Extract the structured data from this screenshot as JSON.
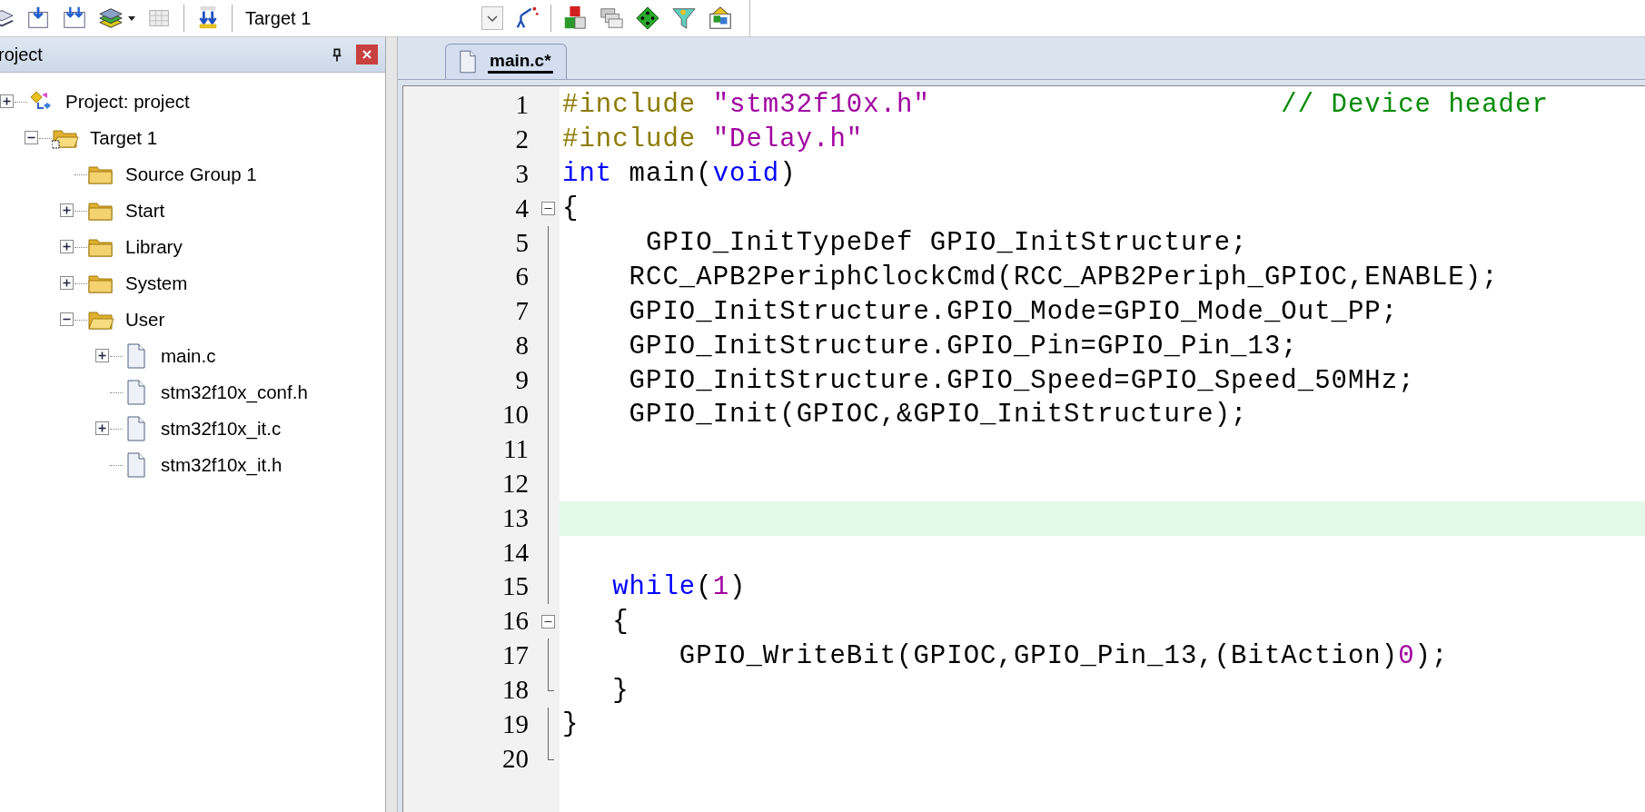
{
  "toolbar": {
    "target": "Target 1"
  },
  "project_panel": {
    "title": "roject",
    "tree": [
      {
        "label": "Project: project",
        "kind": "project",
        "expandable": true,
        "expanded": false,
        "children": [
          {
            "label": "Target 1",
            "kind": "target",
            "expandable": true,
            "expanded": true,
            "children": [
              {
                "label": "Source Group 1",
                "kind": "folder",
                "expandable": false
              },
              {
                "label": "Start",
                "kind": "folder",
                "expandable": true,
                "expanded": false
              },
              {
                "label": "Library",
                "kind": "folder",
                "expandable": true,
                "expanded": false
              },
              {
                "label": "System",
                "kind": "folder",
                "expandable": true,
                "expanded": false
              },
              {
                "label": "User",
                "kind": "folder",
                "expandable": true,
                "expanded": true,
                "children": [
                  {
                    "label": "main.c",
                    "kind": "file",
                    "expandable": true,
                    "expanded": false
                  },
                  {
                    "label": "stm32f10x_conf.h",
                    "kind": "file",
                    "expandable": false
                  },
                  {
                    "label": "stm32f10x_it.c",
                    "kind": "file",
                    "expandable": true,
                    "expanded": false
                  },
                  {
                    "label": "stm32f10x_it.h",
                    "kind": "file",
                    "expandable": false
                  }
                ]
              }
            ]
          }
        ]
      }
    ]
  },
  "editor": {
    "tabs": [
      {
        "label": "main.c*",
        "selected": true
      }
    ],
    "lines": [
      {
        "number": "1",
        "fold_marker": false,
        "fold_end": false,
        "in_fold": false,
        "current": false,
        "tokens": [
          {
            "kind": "preproc",
            "text": "#include "
          },
          {
            "kind": "string",
            "text": "\"stm32f10x.h\""
          },
          {
            "kind": "comment",
            "text": "                     // Device header"
          }
        ]
      },
      {
        "number": "2",
        "fold_marker": false,
        "fold_end": false,
        "in_fold": false,
        "current": false,
        "tokens": [
          {
            "kind": "preproc",
            "text": "#include "
          },
          {
            "kind": "string",
            "text": "\"Delay.h\""
          }
        ]
      },
      {
        "number": "3",
        "fold_marker": false,
        "fold_end": false,
        "in_fold": false,
        "current": false,
        "tokens": [
          {
            "kind": "keyword",
            "text": "int"
          },
          {
            "kind": "plain",
            "text": " main("
          },
          {
            "kind": "keyword",
            "text": "void"
          },
          {
            "kind": "plain",
            "text": ")"
          }
        ]
      },
      {
        "number": "4",
        "fold_marker": true,
        "fold_end": false,
        "in_fold": false,
        "current": false,
        "tokens": [
          {
            "kind": "plain",
            "text": "{"
          }
        ]
      },
      {
        "number": "5",
        "fold_marker": false,
        "fold_end": false,
        "in_fold": true,
        "current": false,
        "tokens": [
          {
            "kind": "plain",
            "text": "     GPIO_InitTypeDef GPIO_InitStructure;"
          }
        ]
      },
      {
        "number": "6",
        "fold_marker": false,
        "fold_end": false,
        "in_fold": true,
        "current": false,
        "tokens": [
          {
            "kind": "plain",
            "text": "    RCC_APB2PeriphClockCmd(RCC_APB2Periph_GPIOC,ENABLE);"
          }
        ]
      },
      {
        "number": "7",
        "fold_marker": false,
        "fold_end": false,
        "in_fold": true,
        "current": false,
        "tokens": [
          {
            "kind": "plain",
            "text": "    GPIO_InitStructure.GPIO_Mode=GPIO_Mode_Out_PP;"
          }
        ]
      },
      {
        "number": "8",
        "fold_marker": false,
        "fold_end": false,
        "in_fold": true,
        "current": false,
        "tokens": [
          {
            "kind": "plain",
            "text": "    GPIO_InitStructure.GPIO_Pin=GPIO_Pin_13;"
          }
        ]
      },
      {
        "number": "9",
        "fold_marker": false,
        "fold_end": false,
        "in_fold": true,
        "current": false,
        "tokens": [
          {
            "kind": "plain",
            "text": "    GPIO_InitStructure.GPIO_Speed=GPIO_Speed_50MHz;"
          }
        ]
      },
      {
        "number": "10",
        "fold_marker": false,
        "fold_end": false,
        "in_fold": true,
        "current": false,
        "tokens": [
          {
            "kind": "plain",
            "text": "    GPIO_Init(GPIOC,&GPIO_InitStructure);"
          }
        ]
      },
      {
        "number": "11",
        "fold_marker": false,
        "fold_end": false,
        "in_fold": true,
        "current": false
      },
      {
        "number": "12",
        "fold_marker": false,
        "fold_end": false,
        "in_fold": true,
        "current": false
      },
      {
        "number": "13",
        "fold_marker": false,
        "fold_end": false,
        "in_fold": true,
        "current": true
      },
      {
        "number": "14",
        "fold_marker": false,
        "fold_end": false,
        "in_fold": true,
        "current": false
      },
      {
        "number": "15",
        "fold_marker": false,
        "fold_end": false,
        "in_fold": true,
        "current": false,
        "tokens": [
          {
            "kind": "keyword",
            "text": "   while"
          },
          {
            "kind": "plain",
            "text": "("
          },
          {
            "kind": "number",
            "text": "1"
          },
          {
            "kind": "plain",
            "text": ")"
          }
        ]
      },
      {
        "number": "16",
        "fold_marker": true,
        "fold_end": false,
        "in_fold": false,
        "current": false,
        "tokens": [
          {
            "kind": "plain",
            "text": "   {"
          }
        ]
      },
      {
        "number": "17",
        "fold_marker": false,
        "fold_end": false,
        "in_fold": true,
        "current": false,
        "tokens": [
          {
            "kind": "plain",
            "text": "       GPIO_WriteBit(GPIOC,GPIO_Pin_13,(BitAction)"
          },
          {
            "kind": "number",
            "text": "0"
          },
          {
            "kind": "plain",
            "text": ");"
          }
        ]
      },
      {
        "number": "18",
        "fold_marker": false,
        "fold_end": true,
        "in_fold": false,
        "current": false,
        "tokens": [
          {
            "kind": "plain",
            "text": "   }"
          }
        ]
      },
      {
        "number": "19",
        "fold_marker": false,
        "fold_end": false,
        "in_fold": true,
        "current": false,
        "tokens": [
          {
            "kind": "plain",
            "text": "}"
          }
        ]
      },
      {
        "number": "20",
        "fold_marker": false,
        "fold_end": true,
        "in_fold": false,
        "current": false
      }
    ]
  }
}
